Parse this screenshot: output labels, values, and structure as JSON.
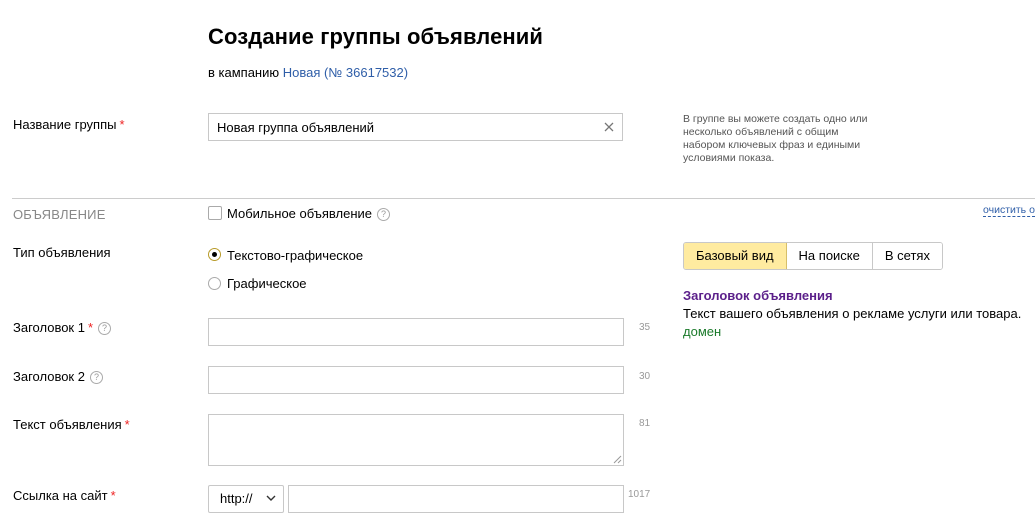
{
  "header": {
    "title": "Создание группы объявлений",
    "subtitle_prefix": "в кампанию",
    "campaign_link": "Новая (№ 36617532)"
  },
  "group": {
    "label": "Название группы",
    "value": "Новая группа объявлений",
    "hint": "В группе вы можете создать одно или несколько объявлений с общим набором ключевых фраз и едиными условиями показа."
  },
  "ad_section": {
    "title": "ОБЪЯВЛЕНИЕ",
    "mobile_label": "Мобильное объявление",
    "clear_link": "очистить о",
    "type_label": "Тип объявления",
    "type_options": [
      "Текстово-графическое",
      "Графическое"
    ],
    "type_selected": "Текстово-графическое"
  },
  "fields": {
    "title1_label": "Заголовок 1",
    "title1_counter": "35",
    "title2_label": "Заголовок 2",
    "title2_counter": "30",
    "text_label": "Текст объявления",
    "text_counter": "81",
    "url_label": "Ссылка на сайт",
    "url_protocol": "http://",
    "url_counter": "1017"
  },
  "preview": {
    "tabs": [
      "Базовый вид",
      "На поиске",
      "В сетях"
    ],
    "active_tab": "Базовый вид",
    "ad_title": "Заголовок объявления",
    "ad_text": "Текст вашего объявления о рекламе услуги или товара.",
    "ad_domain": "домен"
  },
  "colors": {
    "link": "#2f5ea8",
    "required": "#e22222",
    "active_tab": "#ffeba0",
    "ad_title": "#5b1f8a",
    "ad_domain": "#1a7a2a"
  }
}
